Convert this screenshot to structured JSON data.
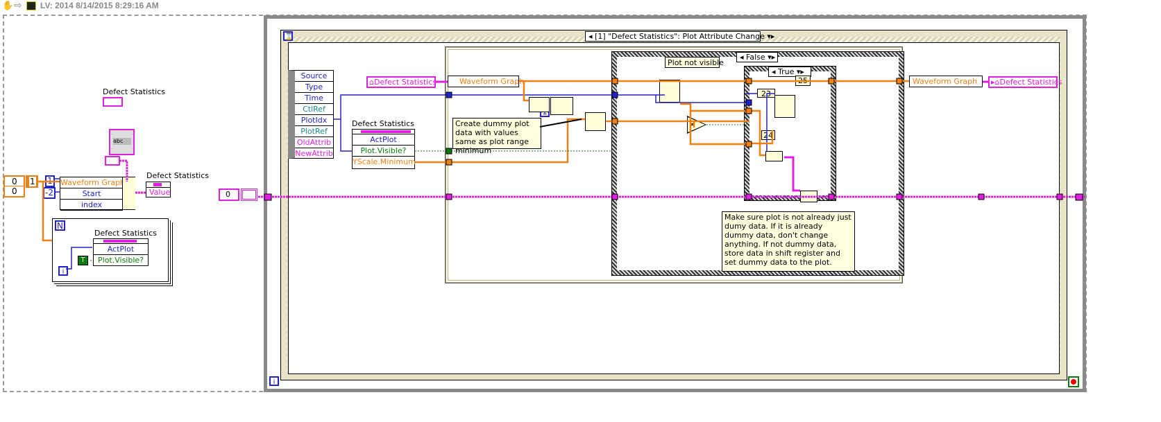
{
  "toolbar": {
    "title": "LV: 2014 8/14/2015 8:29:16 AM",
    "icons": [
      "hand-tool-icon",
      "arrow-icon",
      "vi-icon"
    ]
  },
  "left": {
    "ref_label": "Defect Statistics",
    "prop_label": "Defect Statistics",
    "value_node": "Value",
    "array_values": [
      "0",
      "0"
    ],
    "const_1": "1",
    "const_index_1": "1",
    "const_start": "-2",
    "graph_node": [
      "Waveform Graph",
      "Start",
      "index"
    ],
    "loop_N": "N",
    "loop_i": "i",
    "loop_prop_label": "Defect Statistics",
    "loop_prop": [
      "ActPlot",
      "Plot.Visible?"
    ],
    "true_const": "T",
    "control_value": "0"
  },
  "event": {
    "selector": "[1] \"Defect Statistics\": Plot Attribute Change",
    "data_node": [
      "Source",
      "Type",
      "Time",
      "CtlRef",
      "PlotIdx",
      "PlotRef",
      "OldAttrib",
      "NewAttrib"
    ],
    "ref_in": "Defect Statistics",
    "prop_label": "Defect Statistics",
    "prop": [
      "ActPlot",
      "Plot.Visible?",
      "YScale.Minimum"
    ],
    "graph_node": "Waveform Graph",
    "const_1": "1",
    "comment_dummy": "Create dummy plot data with values same as plot range minimum",
    "case_outer": "False",
    "comment_not_visible": "Plot not visible",
    "case_inner": "True",
    "const_23": "23",
    "const_24": "24",
    "const_25": "25",
    "comment_make_sure": "Make sure plot is not already just dumy data. If it is already dummy data, don't change anything. If not dummy data, store data in shift register and set dummy data to the plot.",
    "graph_node_out": "Waveform Graph",
    "ref_out": "Defect Statistics",
    "loop_i": "i"
  },
  "colors": {
    "wire_orange": "#f08010",
    "wire_blue": "#2222cc",
    "wire_pink": "#e020e0",
    "wire_green": "#0a7a0a"
  }
}
